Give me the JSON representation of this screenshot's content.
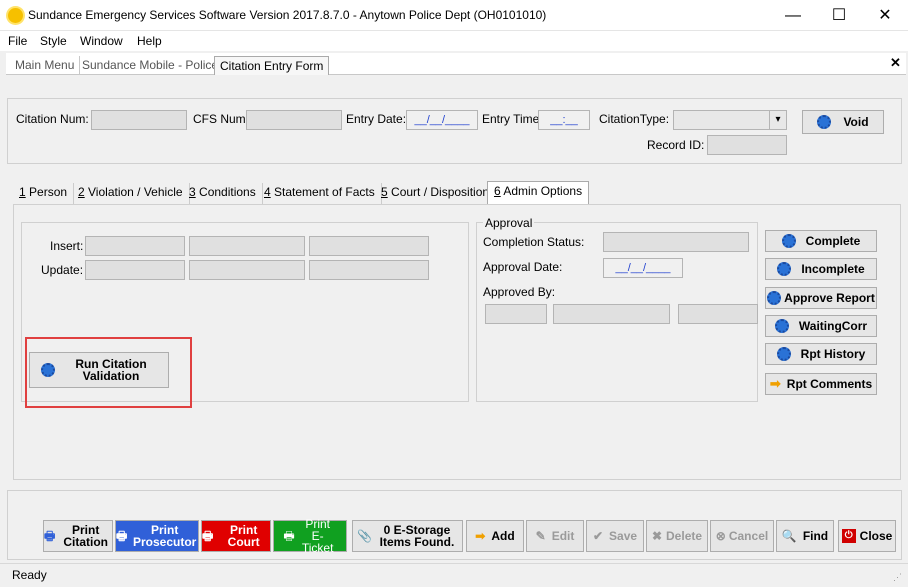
{
  "window": {
    "title": "Sundance Emergency Services Software Version 2017.8.7.0 - Anytown Police Dept (OH0101010)",
    "minimize": "—",
    "maximize": "☐",
    "close": "✕"
  },
  "menu": [
    "File",
    "Style",
    "Window",
    "Help"
  ],
  "doc_tabs": [
    "Main Menu",
    "Sundance Mobile - Police",
    "Citation Entry Form"
  ],
  "doc_close": "✕",
  "header": {
    "citation_num_label": "Citation Num:",
    "cfs_num_label": "CFS Num:",
    "entry_date_label": "Entry Date:",
    "entry_date_value": "__/__/____",
    "entry_time_label": "Entry Time:",
    "entry_time_value": "__:__",
    "citation_type_label": "CitationType:",
    "record_id_label": "Record ID:",
    "void_label": "Void"
  },
  "tabs": [
    {
      "key": "1",
      "label": " Person"
    },
    {
      "key": "2",
      "label": " Violation / Vehicle"
    },
    {
      "key": "3",
      "label": " Conditions"
    },
    {
      "key": "4",
      "label": " Statement of Facts"
    },
    {
      "key": "5",
      "label": " Court / Disposition"
    },
    {
      "key": "6",
      "label": " Admin Options"
    }
  ],
  "admin": {
    "insert_label": "Insert:",
    "update_label": "Update:",
    "run_validation_label": "Run Citation Validation"
  },
  "approval": {
    "group_label": "Approval",
    "completion_status_label": "Completion Status:",
    "approval_date_label": "Approval Date:",
    "approval_date_value": "__/__/____",
    "approved_by_label": "Approved By:",
    "buttons": [
      "Complete",
      "Incomplete",
      "Approve Report",
      "WaitingCorr",
      "Rpt History",
      "Rpt Comments"
    ]
  },
  "bottom": {
    "print_citation": "Print Citation",
    "print_prosecutor": "Print Prosecutor",
    "print_court": "Print Court",
    "print_eticket": "Print E-Ticket",
    "estorage": "0 E-Storage Items Found.",
    "add": "Add",
    "edit": "Edit",
    "save": "Save",
    "delete": "Delete",
    "cancel": "Cancel",
    "find": "Find",
    "close": "Close"
  },
  "status": "Ready",
  "colors": {
    "prosecutor": "#3060d8",
    "court": "#e00000",
    "eticket": "#10a020",
    "highlight": "#e04040"
  }
}
